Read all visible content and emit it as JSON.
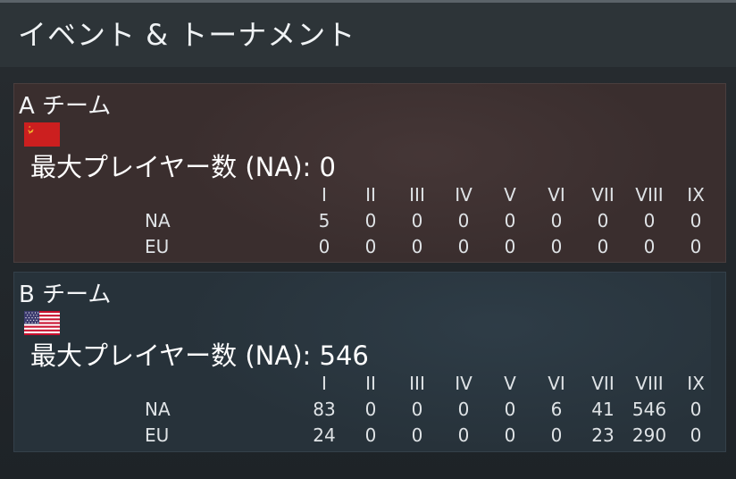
{
  "header": {
    "title": "イベント & トーナメント"
  },
  "columns": [
    "I",
    "II",
    "III",
    "IV",
    "V",
    "VI",
    "VII",
    "VIII",
    "IX"
  ],
  "teams": [
    {
      "name": "A チーム",
      "flag": "ussr-flag-icon",
      "max_players": "最大プレイヤー数 (NA): 0",
      "rows": [
        {
          "label": "NA",
          "values": [
            "5",
            "0",
            "0",
            "0",
            "0",
            "0",
            "0",
            "0",
            "0"
          ]
        },
        {
          "label": "EU",
          "values": [
            "0",
            "0",
            "0",
            "0",
            "0",
            "0",
            "0",
            "0",
            "0"
          ]
        }
      ]
    },
    {
      "name": "B チーム",
      "flag": "usa-flag-icon",
      "max_players": "最大プレイヤー数 (NA): 546",
      "rows": [
        {
          "label": "NA",
          "values": [
            "83",
            "0",
            "0",
            "0",
            "0",
            "6",
            "41",
            "546",
            "0"
          ]
        },
        {
          "label": "EU",
          "values": [
            "24",
            "0",
            "0",
            "0",
            "0",
            "0",
            "23",
            "290",
            "0"
          ]
        }
      ]
    }
  ],
  "colors": {
    "background": "#2d3438",
    "team_a_panel": "#3a2e2e",
    "team_b_panel": "#27323a",
    "ussr_red": "#cc1f1f",
    "ussr_gold": "#f2c230"
  }
}
